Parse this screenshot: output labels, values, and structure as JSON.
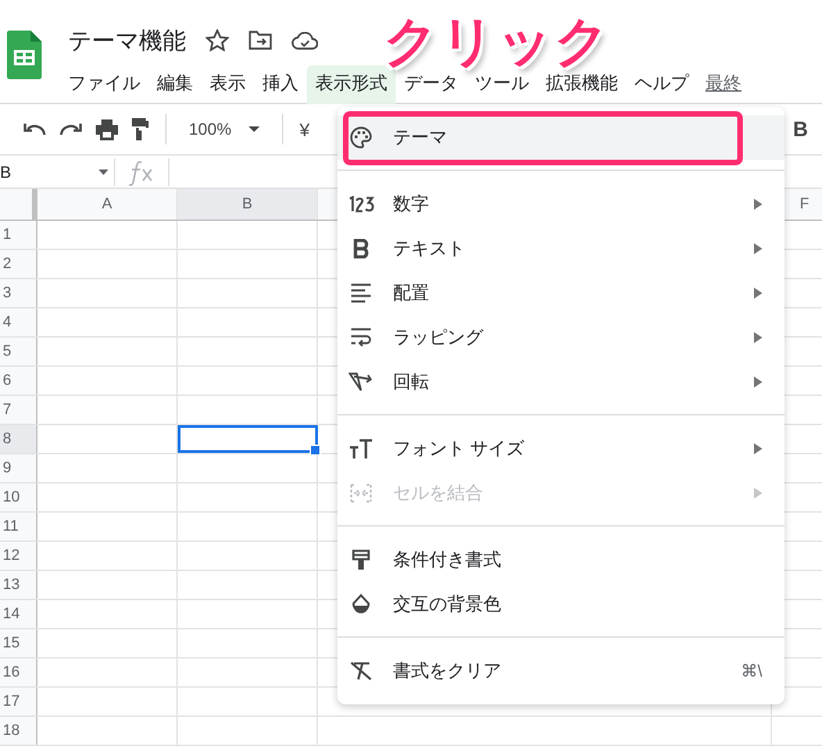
{
  "document": {
    "title": "テーマ機能"
  },
  "menubar": [
    {
      "label": "ファイル",
      "selected": false
    },
    {
      "label": "編集",
      "selected": false
    },
    {
      "label": "表示",
      "selected": false
    },
    {
      "label": "挿入",
      "selected": false
    },
    {
      "label": "表示形式",
      "selected": true
    },
    {
      "label": "データ",
      "selected": false
    },
    {
      "label": "ツール",
      "selected": false
    },
    {
      "label": "拡張機能",
      "selected": false
    },
    {
      "label": "ヘルプ",
      "selected": false
    }
  ],
  "last_edit": "最終",
  "toolbar": {
    "zoom": "100%",
    "currency": "¥",
    "bold": "B"
  },
  "name_box": "B",
  "columns": [
    {
      "label": "A",
      "selected": false
    },
    {
      "label": "B",
      "selected": true
    },
    {
      "label": "F",
      "selected": false
    }
  ],
  "rows": [
    {
      "label": "1",
      "selected": false
    },
    {
      "label": "2",
      "selected": false
    },
    {
      "label": "3",
      "selected": false
    },
    {
      "label": "4",
      "selected": false
    },
    {
      "label": "5",
      "selected": false
    },
    {
      "label": "6",
      "selected": false
    },
    {
      "label": "7",
      "selected": false
    },
    {
      "label": "8",
      "selected": true
    },
    {
      "label": "9",
      "selected": false
    },
    {
      "label": "10",
      "selected": false
    },
    {
      "label": "11",
      "selected": false
    },
    {
      "label": "12",
      "selected": false
    },
    {
      "label": "13",
      "selected": false
    },
    {
      "label": "14",
      "selected": false
    },
    {
      "label": "15",
      "selected": false
    },
    {
      "label": "16",
      "selected": false
    },
    {
      "label": "17",
      "selected": false
    },
    {
      "label": "18",
      "selected": false
    }
  ],
  "format_menu": [
    {
      "kind": "item",
      "label": "テーマ",
      "submenu": false,
      "disabled": false,
      "selected": true,
      "annotated": true
    },
    {
      "kind": "divider"
    },
    {
      "kind": "item",
      "label": "数字",
      "submenu": true,
      "disabled": false,
      "selected": false,
      "annotated": false
    },
    {
      "kind": "item",
      "label": "テキスト",
      "submenu": true,
      "disabled": false,
      "selected": false,
      "annotated": false
    },
    {
      "kind": "item",
      "label": "配置",
      "submenu": true,
      "disabled": false,
      "selected": false,
      "annotated": false
    },
    {
      "kind": "item",
      "label": "ラッピング",
      "submenu": true,
      "disabled": false,
      "selected": false,
      "annotated": false
    },
    {
      "kind": "item",
      "label": "回転",
      "submenu": true,
      "disabled": false,
      "selected": false,
      "annotated": false
    },
    {
      "kind": "divider"
    },
    {
      "kind": "item",
      "label": "フォント サイズ",
      "submenu": true,
      "disabled": false,
      "selected": false,
      "annotated": false
    },
    {
      "kind": "item",
      "label": "セルを結合",
      "submenu": true,
      "disabled": true,
      "selected": false,
      "annotated": false
    },
    {
      "kind": "divider"
    },
    {
      "kind": "item",
      "label": "条件付き書式",
      "submenu": false,
      "disabled": false,
      "selected": false,
      "annotated": false
    },
    {
      "kind": "item",
      "label": "交互の背景色",
      "submenu": false,
      "disabled": false,
      "selected": false,
      "annotated": false
    },
    {
      "kind": "divider"
    },
    {
      "kind": "item",
      "label": "書式をクリア",
      "shortcut": "⌘\\",
      "submenu": false,
      "disabled": false,
      "selected": false,
      "annotated": false
    }
  ],
  "annotation": {
    "text": "クリック"
  }
}
